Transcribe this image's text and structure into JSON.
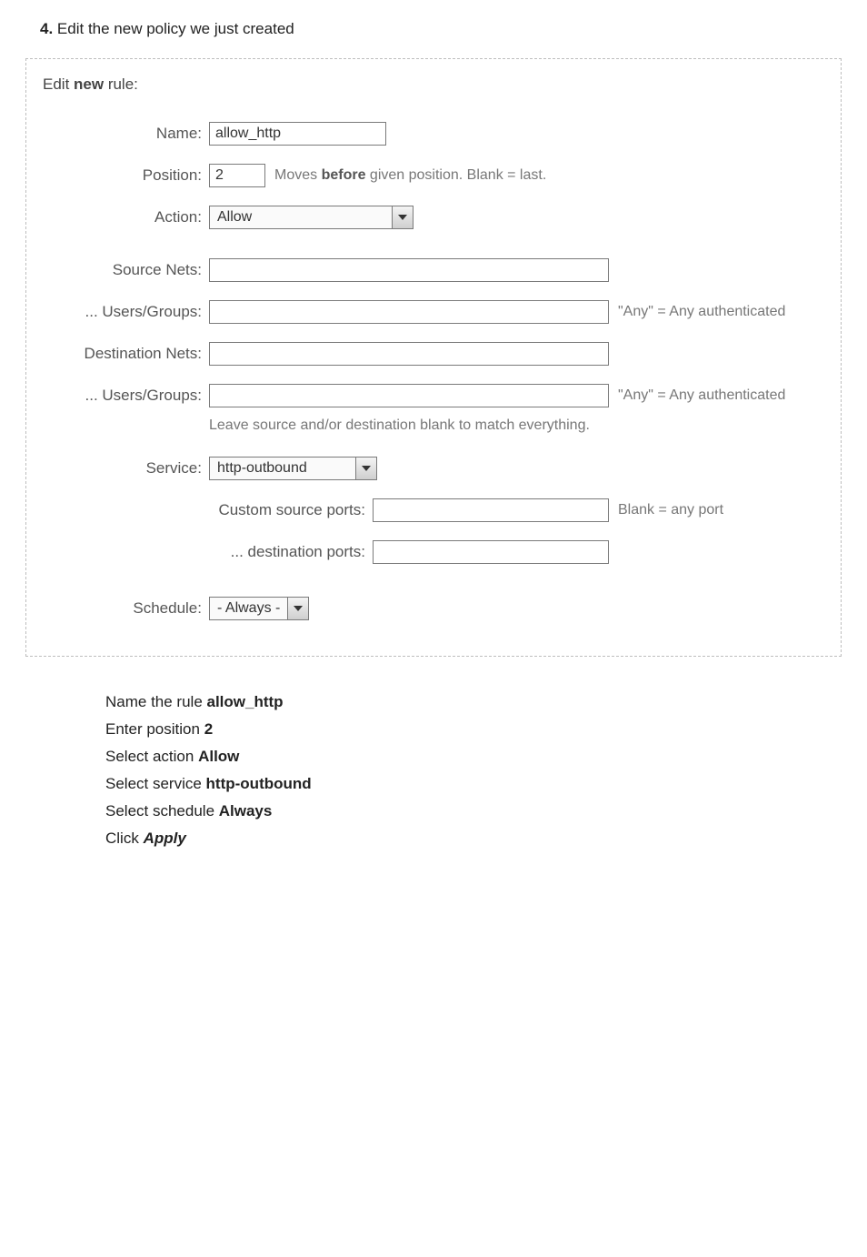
{
  "step": {
    "number": "4.",
    "text": "Edit the new policy we just created"
  },
  "panel": {
    "title_prefix": "Edit ",
    "title_bold": "new",
    "title_suffix": " rule:"
  },
  "labels": {
    "name": "Name:",
    "position": "Position:",
    "action": "Action:",
    "source_nets": "Source Nets:",
    "users_groups1": "... Users/Groups:",
    "destination_nets": "Destination Nets:",
    "users_groups2": "... Users/Groups:",
    "service": "Service:",
    "schedule": "Schedule:",
    "custom_source_ports": "Custom source ports:",
    "destination_ports": "... destination ports:"
  },
  "values": {
    "name": "allow_http",
    "position": "2",
    "action": "Allow",
    "source_nets": "",
    "users_groups1": "",
    "destination_nets": "",
    "users_groups2": "",
    "service": "http-outbound",
    "custom_source_ports": "",
    "destination_ports": "",
    "schedule": "- Always -"
  },
  "hints": {
    "position_pre": "Moves ",
    "position_bold": "before",
    "position_post": " given position. Blank = last.",
    "any_auth": "\"Any\" = Any authenticated",
    "blank_match": "Leave source and/or destination blank to match everything.",
    "blank_port": "Blank = any port"
  },
  "instructions": {
    "l1_pre": "Name the rule ",
    "l1_bold": "allow_http",
    "l2_pre": "Enter position ",
    "l2_bold": "2",
    "l3_pre": "Select action ",
    "l3_bold": "Allow",
    "l4_pre": "Select service ",
    "l4_bold": "http-outbound",
    "l5_pre": "Select schedule ",
    "l5_bold": "Always",
    "l6_pre": "Click ",
    "l6_bi": "Apply"
  }
}
